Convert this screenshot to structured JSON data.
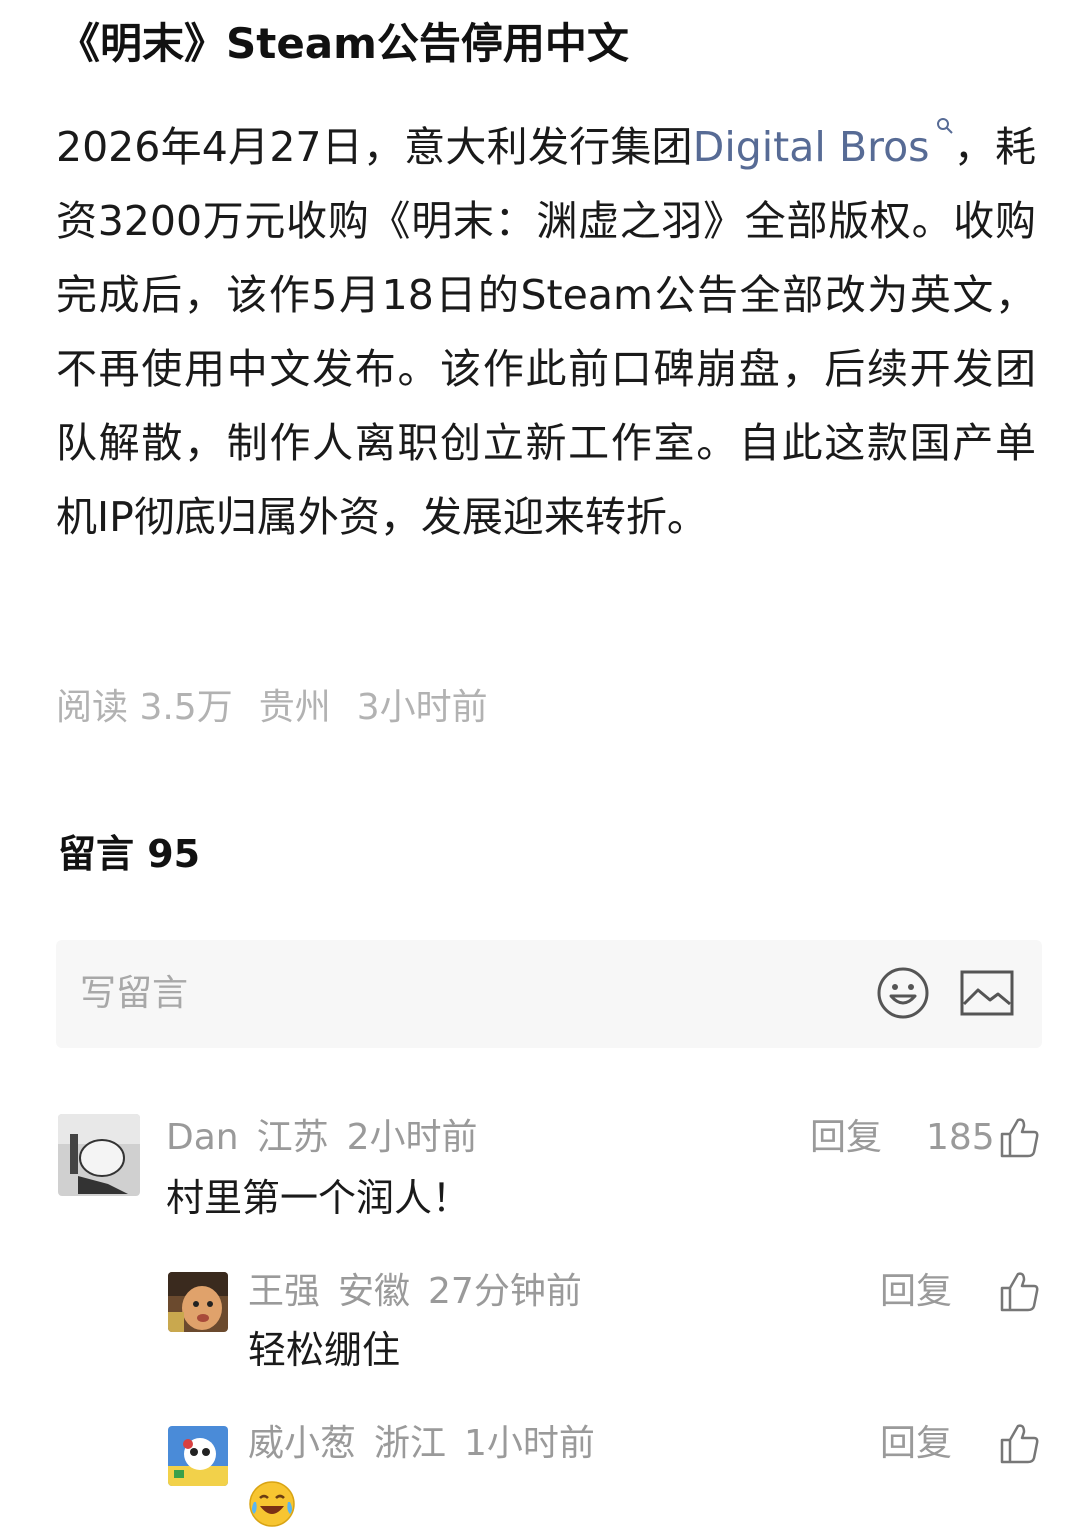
{
  "article": {
    "title": "《明末》Steam公告停用中文",
    "body_before_link": "2026年4月27日，意大利发行集团",
    "link_text": "Digital Bros",
    "body_after_link": "，耗资3200万元收购《明末：渊虚之羽》全部版权。收购完成后，该作5月18日的Steam公告全部改为英文，不再使用中文发布。该作此前口碑崩盘，后续开发团队解散，制作人离职创立新工作室。自此这款国产单机IP彻底归属外资，发展迎来转折。",
    "reads": "阅读 3.5万",
    "location": "贵州",
    "time": "3小时前"
  },
  "comments_section": {
    "header": "留言 95",
    "input_placeholder": "写留言"
  },
  "comments": [
    {
      "user": "Dan",
      "location": "江苏",
      "time": "2小时前",
      "text": "村里第一个润人！",
      "reply_label": "回复",
      "likes": "185"
    },
    {
      "user": "王强",
      "location": "安徽",
      "time": "27分钟前",
      "text": "轻松绷住",
      "reply_label": "回复"
    },
    {
      "user": "威小葱",
      "location": "浙江",
      "time": "1小时前",
      "text": "",
      "reply_label": "回复"
    }
  ],
  "icons": {
    "search": "search-icon",
    "emoji": "smiley-icon",
    "image": "image-icon",
    "like": "thumbs-up-icon",
    "laugh_emoji": "laughing-crying-emoji"
  },
  "colors": {
    "link": "#576b95",
    "meta": "#b2b2b2",
    "input_bg": "#f7f7f7"
  }
}
